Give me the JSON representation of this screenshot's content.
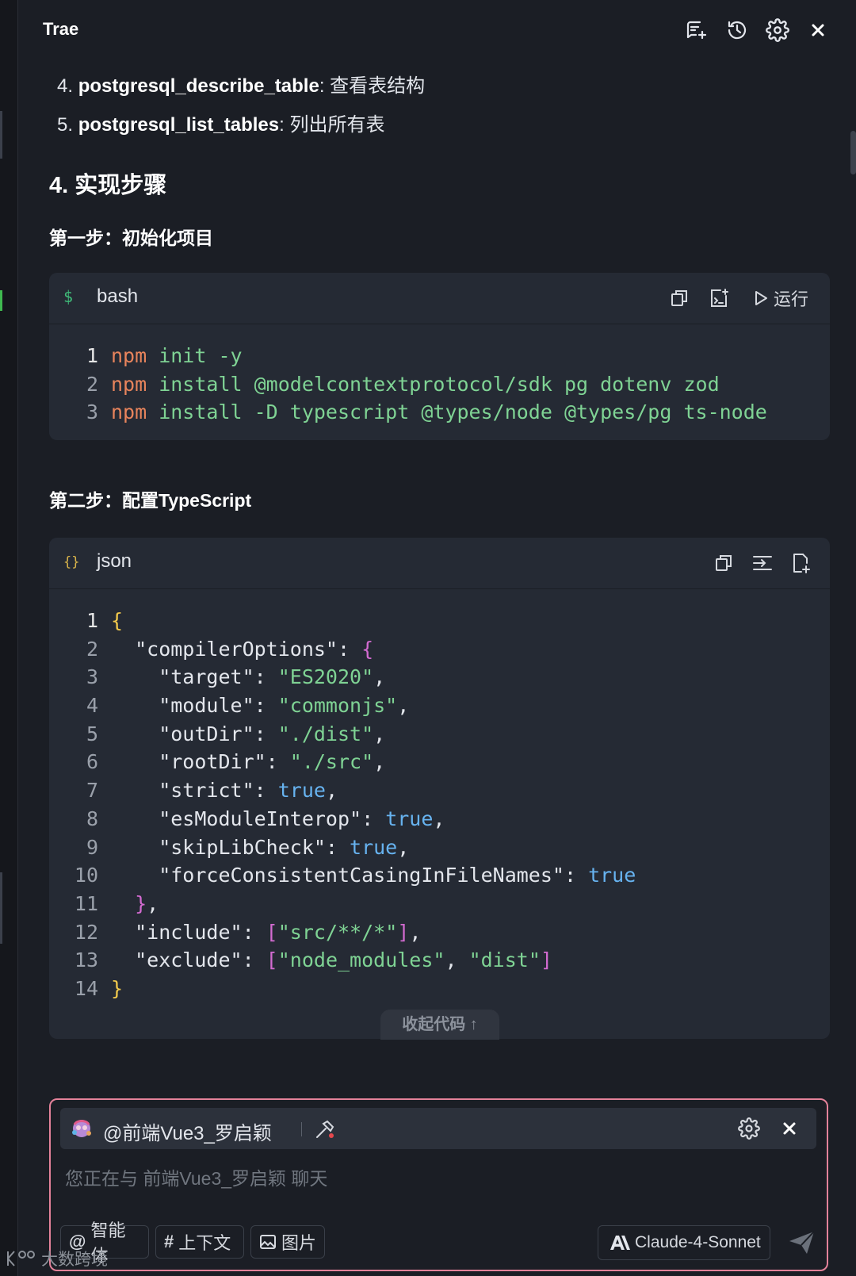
{
  "header": {
    "title": "Trae",
    "icons": [
      "new-chat-icon",
      "history-icon",
      "settings-icon",
      "close-icon"
    ]
  },
  "list": [
    {
      "number": "4.",
      "name": "postgresql_describe_table",
      "desc": ": 查看表结构"
    },
    {
      "number": "5.",
      "name": "postgresql_list_tables",
      "desc": ": 列出所有表"
    }
  ],
  "section_heading": "4. 实现步骤",
  "step1": {
    "heading": "第一步：初始化项目",
    "code_block": {
      "lang_icon": "$",
      "lang": "bash",
      "run_label": "运行",
      "lines": [
        {
          "num": "1",
          "tokens": [
            {
              "t": "npm",
              "c": "orange"
            },
            {
              "t": " init -y",
              "c": "green"
            }
          ]
        },
        {
          "num": "2",
          "tokens": [
            {
              "t": "npm",
              "c": "orange"
            },
            {
              "t": " install @modelcontextprotocol/sdk pg dotenv zod",
              "c": "green"
            }
          ]
        },
        {
          "num": "3",
          "tokens": [
            {
              "t": "npm",
              "c": "orange"
            },
            {
              "t": " install -D typescript @types/node @types/pg ts-node",
              "c": "green"
            }
          ]
        }
      ]
    }
  },
  "step2": {
    "heading": "第二步：配置TypeScript",
    "code_block": {
      "lang_icon": "{}",
      "lang": "json",
      "collapse_label": "收起代码 ↑",
      "lines": [
        {
          "num": "1",
          "tokens": [
            {
              "t": "{",
              "c": "yellow"
            }
          ]
        },
        {
          "num": "2",
          "tokens": [
            {
              "t": "  \"compilerOptions\": ",
              "c": "white"
            },
            {
              "t": "{",
              "c": "pink"
            }
          ]
        },
        {
          "num": "3",
          "tokens": [
            {
              "t": "    \"target\": ",
              "c": "white"
            },
            {
              "t": "\"ES2020\"",
              "c": "green"
            },
            {
              "t": ",",
              "c": "white"
            }
          ]
        },
        {
          "num": "4",
          "tokens": [
            {
              "t": "    \"module\": ",
              "c": "white"
            },
            {
              "t": "\"commonjs\"",
              "c": "green"
            },
            {
              "t": ",",
              "c": "white"
            }
          ]
        },
        {
          "num": "5",
          "tokens": [
            {
              "t": "    \"outDir\": ",
              "c": "white"
            },
            {
              "t": "\"./dist\"",
              "c": "green"
            },
            {
              "t": ",",
              "c": "white"
            }
          ]
        },
        {
          "num": "6",
          "tokens": [
            {
              "t": "    \"rootDir\": ",
              "c": "white"
            },
            {
              "t": "\"./src\"",
              "c": "green"
            },
            {
              "t": ",",
              "c": "white"
            }
          ]
        },
        {
          "num": "7",
          "tokens": [
            {
              "t": "    \"strict\": ",
              "c": "white"
            },
            {
              "t": "true",
              "c": "blue"
            },
            {
              "t": ",",
              "c": "white"
            }
          ]
        },
        {
          "num": "8",
          "tokens": [
            {
              "t": "    \"esModuleInterop\": ",
              "c": "white"
            },
            {
              "t": "true",
              "c": "blue"
            },
            {
              "t": ",",
              "c": "white"
            }
          ]
        },
        {
          "num": "9",
          "tokens": [
            {
              "t": "    \"skipLibCheck\": ",
              "c": "white"
            },
            {
              "t": "true",
              "c": "blue"
            },
            {
              "t": ",",
              "c": "white"
            }
          ]
        },
        {
          "num": "10",
          "tokens": [
            {
              "t": "    \"forceConsistentCasingInFileNames\": ",
              "c": "white"
            },
            {
              "t": "true",
              "c": "blue"
            }
          ]
        },
        {
          "num": "11",
          "tokens": [
            {
              "t": "  }",
              "c": "pink"
            },
            {
              "t": ",",
              "c": "white"
            }
          ]
        },
        {
          "num": "12",
          "tokens": [
            {
              "t": "  \"include\": ",
              "c": "white"
            },
            {
              "t": "[",
              "c": "pink"
            },
            {
              "t": "\"src/**/*\"",
              "c": "green"
            },
            {
              "t": "]",
              "c": "pink"
            },
            {
              "t": ",",
              "c": "white"
            }
          ]
        },
        {
          "num": "13",
          "tokens": [
            {
              "t": "  \"exclude\": ",
              "c": "white"
            },
            {
              "t": "[",
              "c": "pink"
            },
            {
              "t": "\"node_modules\"",
              "c": "green"
            },
            {
              "t": ", ",
              "c": "white"
            },
            {
              "t": "\"dist\"",
              "c": "green"
            },
            {
              "t": "]",
              "c": "pink"
            }
          ]
        },
        {
          "num": "14",
          "tokens": [
            {
              "t": "}",
              "c": "yellow"
            }
          ]
        }
      ]
    }
  },
  "chat": {
    "agent_label": "@前端Vue3_罗启颖",
    "placeholder": "您正在与 前端Vue3_罗启颖 聊天",
    "pills": [
      {
        "icon": "@",
        "label": "智能体"
      },
      {
        "icon": "#",
        "label": "上下文"
      },
      {
        "icon": "image-icon",
        "label": "图片"
      }
    ],
    "model_label": "Claude-4-Sonnet"
  },
  "watermark": "大数跨境",
  "colors": {
    "background": "#1b1e25",
    "code_bg": "#252a34",
    "chat_border": "#e4829a",
    "orange": "#e8845c",
    "green": "#7fd394",
    "blue": "#67b3f0",
    "yellow": "#f2c94c",
    "pink": "#d36bd1"
  }
}
